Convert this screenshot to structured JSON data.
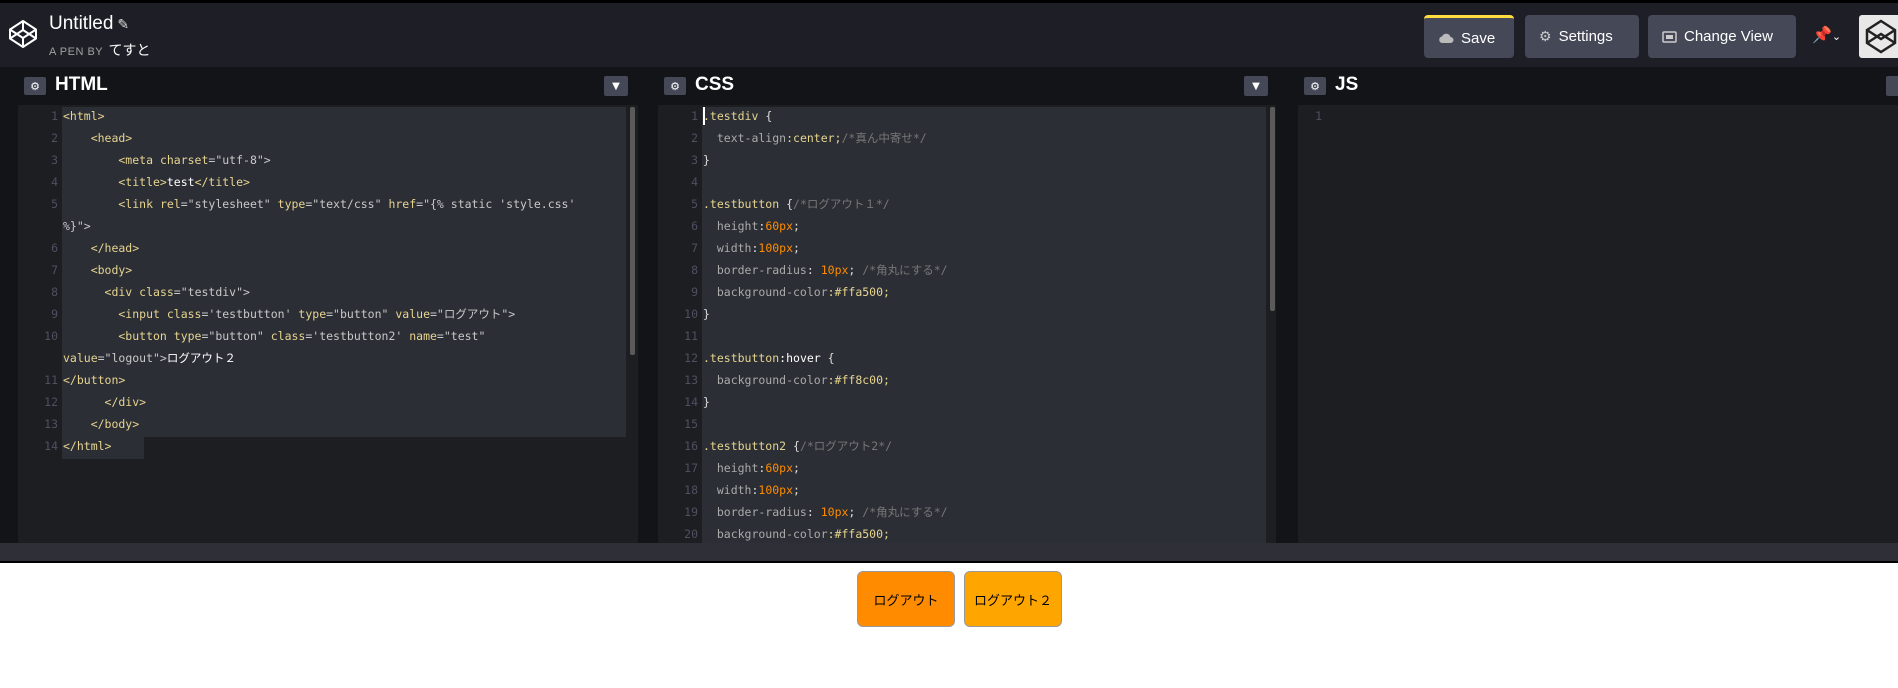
{
  "header": {
    "title": "Untitled",
    "byline_prefix": "A PEN BY",
    "author": "てすと",
    "save_label": "Save",
    "settings_label": "Settings",
    "change_view_label": "Change View"
  },
  "panes": {
    "html": {
      "name": "HTML"
    },
    "css": {
      "name": "CSS"
    },
    "js": {
      "name": "JS"
    }
  },
  "html_code": {
    "line_numbers": [
      "1",
      "2",
      "3",
      "4",
      "5",
      "6",
      "7",
      "8",
      "9",
      "10",
      "11",
      "12",
      "13",
      "14"
    ],
    "l1": "<html>",
    "l2": "    <head>",
    "l3_pre": "        <meta ",
    "l3_attr": "charset",
    "l3_post": "=\"utf-8\">",
    "l4_pre": "        <title>",
    "l4_txt": "test",
    "l4_post": "</title>",
    "l5_pre": "        <link ",
    "l5_a1": "rel",
    "l5_v1": "=\"stylesheet\" ",
    "l5_a2": "type",
    "l5_v2": "=\"text/css\" ",
    "l5_a3": "href",
    "l5_v3": "=\"{% static 'style.css'",
    "l5b": "%}\">",
    "l6": "    </head>",
    "l7": "    <body>",
    "l8_pre": "      <div ",
    "l8_attr": "class",
    "l8_post": "=\"testdiv\">",
    "l9_pre": "        <input ",
    "l9_a1": "class",
    "l9_v1": "='testbutton' ",
    "l9_a2": "type",
    "l9_v2": "=\"button\" ",
    "l9_a3": "value",
    "l9_v3": "=\"ログアウト\">",
    "l10_pre": "        <button ",
    "l10_a1": "type",
    "l10_v1": "=\"button\" ",
    "l10_a2": "class",
    "l10_v2": "='testbutton2' ",
    "l10_a3": "name",
    "l10_v3": "=\"test\"",
    "l10b_a": "value",
    "l10b_v": "=\"logout\">",
    "l10b_txt": "ログアウト２",
    "l11": "</button>",
    "l12": "      </div>",
    "l13": "    </body>",
    "l14": "</html>"
  },
  "css_code": {
    "line_numbers": [
      "1",
      "2",
      "3",
      "4",
      "5",
      "6",
      "7",
      "8",
      "9",
      "10",
      "11",
      "12",
      "13",
      "14",
      "15",
      "16",
      "17",
      "18",
      "19",
      "20"
    ],
    "l1_sel": ".testdiv",
    "l1_rest": " {",
    "l2_prop": "  text-align",
    "l2_val": ":center;",
    "l2_cmt": "/*真ん中寄せ*/",
    "l3": "}",
    "l5_sel": ".testbutton",
    "l5_rest": " {",
    "l5_cmt": "/*ログアウト１*/",
    "l6_prop": "  height",
    "l6_num": "60px",
    "l6_end": ";",
    "l7_prop": "  width",
    "l7_num": "100px",
    "l7_end": ";",
    "l8_prop": "  border-radius",
    "l8_sep": ": ",
    "l8_num": "10px",
    "l8_end": "; ",
    "l8_cmt": "/*角丸にする*/",
    "l9_prop": "  background-color",
    "l9_val": ":#ffa500;",
    "l10": "}",
    "l12_sel": ".testbutton",
    "l12_ps": ":hover",
    "l12_rest": " {",
    "l13_prop": "  background-color",
    "l13_val": ":#ff8c00;",
    "l14": "}",
    "l16_sel": ".testbutton2",
    "l16_rest": " {",
    "l16_cmt": "/*ログアウト2*/",
    "l17_prop": "  height",
    "l17_num": "60px",
    "l17_end": ";",
    "l18_prop": "  width",
    "l18_num": "100px",
    "l18_end": ";",
    "l19_prop": "  border-radius",
    "l19_sep": ": ",
    "l19_num": "10px",
    "l19_end": "; ",
    "l19_cmt": "/*角丸にする*/",
    "l20_prop": "  background-color",
    "l20_val": ":#ffa500;"
  },
  "js_code": {
    "line_numbers": [
      "1"
    ]
  },
  "result": {
    "button1_label": "ログアウト",
    "button1_color": "#ff8c00",
    "button2_label": "ログアウト２",
    "button2_color": "#ffa500"
  },
  "icons": [
    "codepen-logo-icon",
    "pencil-icon",
    "cloud-icon",
    "gear-icon",
    "change-view-icon",
    "pin-icon",
    "chevron-down-icon",
    "avatar"
  ],
  "colors": {
    "accent_save": "#ffdd40",
    "topbar": "#1e1f26",
    "editor_bg": "#1d1e22"
  }
}
